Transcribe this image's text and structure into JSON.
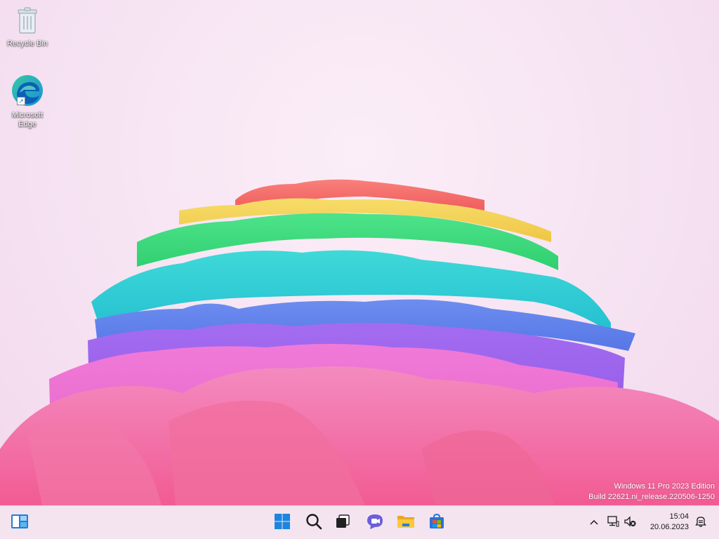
{
  "desktop": {
    "icons": [
      {
        "label": "Recycle Bin",
        "icon": "recycle-bin-icon"
      },
      {
        "label": "Microsoft Edge",
        "icon": "edge-icon"
      }
    ],
    "watermark": {
      "line1": "Windows 11 Pro 2023 Edition",
      "line2": "Build 22621.ni_release.220506-1250"
    }
  },
  "taskbar": {
    "widgets_icon": "widgets-icon",
    "pinned": [
      {
        "name": "Start",
        "icon": "windows-logo-icon"
      },
      {
        "name": "Search",
        "icon": "search-icon"
      },
      {
        "name": "Task View",
        "icon": "task-view-icon"
      },
      {
        "name": "Chat",
        "icon": "chat-icon"
      },
      {
        "name": "File Explorer",
        "icon": "folder-icon"
      },
      {
        "name": "Microsoft Store",
        "icon": "store-icon"
      }
    ],
    "tray": {
      "time": "15:04",
      "date": "20.06.2023",
      "icons": [
        "chevron-up-icon",
        "network-disconnected-icon",
        "speaker-muted-icon",
        "notification-icon"
      ]
    }
  },
  "colors": {
    "taskbar_bg": "#f3e4ef",
    "windows_blue": "#0a78d4"
  }
}
